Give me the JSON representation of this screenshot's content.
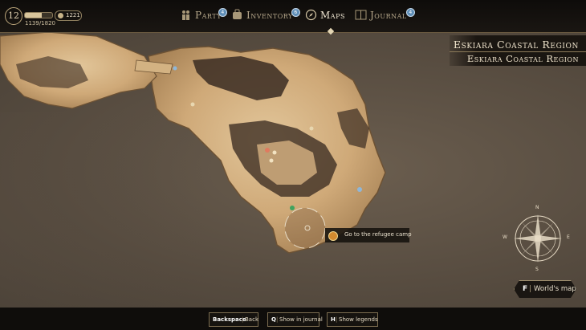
{
  "player": {
    "level": "12",
    "xp_text": "1139/1820",
    "xp_fraction": 0.626,
    "gold": "1221"
  },
  "tabs": [
    {
      "label": "Party",
      "badge": "4",
      "icon": "party-icon",
      "active": false
    },
    {
      "label": "Inventory",
      "badge": "6",
      "icon": "inventory-icon",
      "active": false
    },
    {
      "label": "Maps",
      "badge": "",
      "icon": "compass-icon",
      "active": true
    },
    {
      "label": "Journal",
      "badge": "4",
      "icon": "journal-icon",
      "active": false
    }
  ],
  "region": {
    "title": "Eskiara Coastal Region",
    "subtitle": "Eskiara Coastal Region"
  },
  "quest_tooltip": {
    "text": "Go to the refugee camp",
    "icon": "quest-marker-icon"
  },
  "compass": {
    "north": "N",
    "south": "S",
    "east": "E",
    "west": "W"
  },
  "world_map_button": {
    "key": "F",
    "label": "World's map"
  },
  "hints": [
    {
      "key": "Backspace",
      "label": "Back"
    },
    {
      "key": "Q",
      "label": "Show in journal"
    },
    {
      "key": "H",
      "label": "Show legends"
    }
  ],
  "colors": {
    "land": "#d8b88a",
    "rock": "#3a2c22",
    "sea": "#5b5044",
    "accent": "#d38a2f",
    "badge": "#5f8fb8"
  }
}
